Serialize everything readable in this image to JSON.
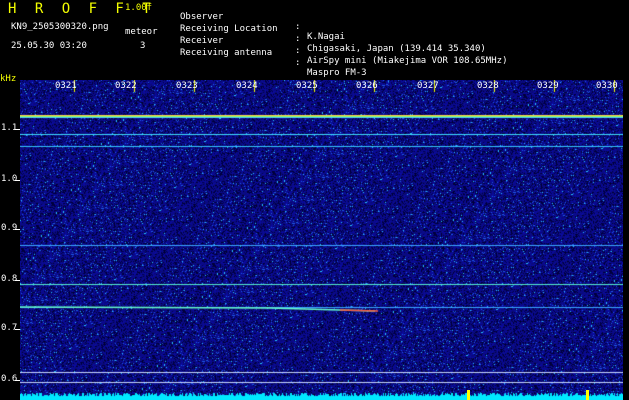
{
  "header": {
    "app_title": "H R O F F T",
    "app_version": "1.00f",
    "file_name": "KN9_2505300320.png",
    "timestamp": "25.05.30 03:20",
    "meteor_label": "meteor",
    "meteor_count": "3"
  },
  "info": [
    {
      "key": "Observer",
      "sep": ":",
      "value": "K.Nagai"
    },
    {
      "key": "Receiving Location",
      "sep": ":",
      "value": "Chigasaki, Japan (139.414 35.340)"
    },
    {
      "key": "Receiver",
      "sep": ":",
      "value": "AirSpy mini (Miakejima VOR 108.65MHz)"
    },
    {
      "key": "Receiving antenna",
      "sep": ":",
      "value": "Maspro FM-3"
    }
  ],
  "axis": {
    "y_unit": "kHz",
    "time_labels": [
      "0321",
      "0322",
      "0323",
      "0324",
      "0325",
      "0326",
      "0327",
      "0328",
      "0329",
      "0330"
    ],
    "freq_labels": [
      "1.1",
      "1.0",
      "0.9",
      "0.8",
      "0.7",
      "0.6"
    ]
  },
  "colors": {
    "accent": "#f4ff00",
    "background": "#000000",
    "noise_base": "#1a1ab4",
    "bottom_band": "#00ffff"
  }
}
